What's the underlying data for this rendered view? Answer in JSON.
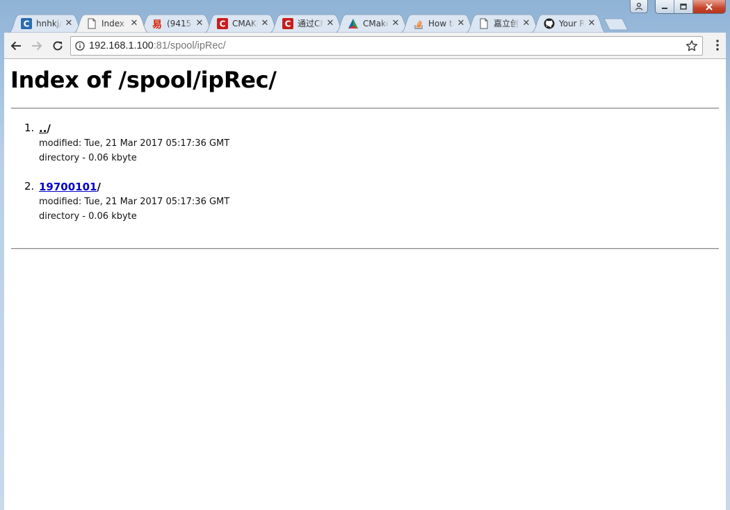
{
  "browser": {
    "tabs": [
      {
        "title": "hnhkj/",
        "icon": "csdn-c-blue-icon",
        "active": false
      },
      {
        "title": "Index of /spool/ipRec/",
        "icon": "page-icon",
        "active": true
      },
      {
        "title": "(9415",
        "icon": "yi-red-icon",
        "active": false
      },
      {
        "title": "CMAKE",
        "icon": "csdn-c-red-icon",
        "active": false
      },
      {
        "title": "通过CMake",
        "icon": "csdn-c-red-icon",
        "active": false
      },
      {
        "title": "CMake",
        "icon": "cmake-triangle-icon",
        "active": false
      },
      {
        "title": "How to",
        "icon": "stackoverflow-icon",
        "active": false
      },
      {
        "title": "嘉立创",
        "icon": "page-icon",
        "active": false
      },
      {
        "title": "Your R",
        "icon": "github-icon",
        "active": false
      }
    ],
    "address": {
      "host": "192.168.1.100",
      "rest": ":81/spool/ipRec/"
    }
  },
  "page": {
    "heading": "Index of /spool/ipRec/",
    "entries": [
      {
        "num": "1.",
        "link": "..",
        "slash": "/",
        "modified": "modified: Tue, 21 Mar 2017 05:17:36 GMT",
        "info": "directory - 0.06 kbyte"
      },
      {
        "num": "2.",
        "link": "19700101",
        "slash": "/",
        "modified": "modified: Tue, 21 Mar 2017 05:17:36 GMT",
        "info": "directory - 0.06 kbyte"
      }
    ]
  },
  "colors": {
    "link": "#0000cc",
    "toolbar": "#f2f2f2",
    "close_button": "#c7442b"
  }
}
